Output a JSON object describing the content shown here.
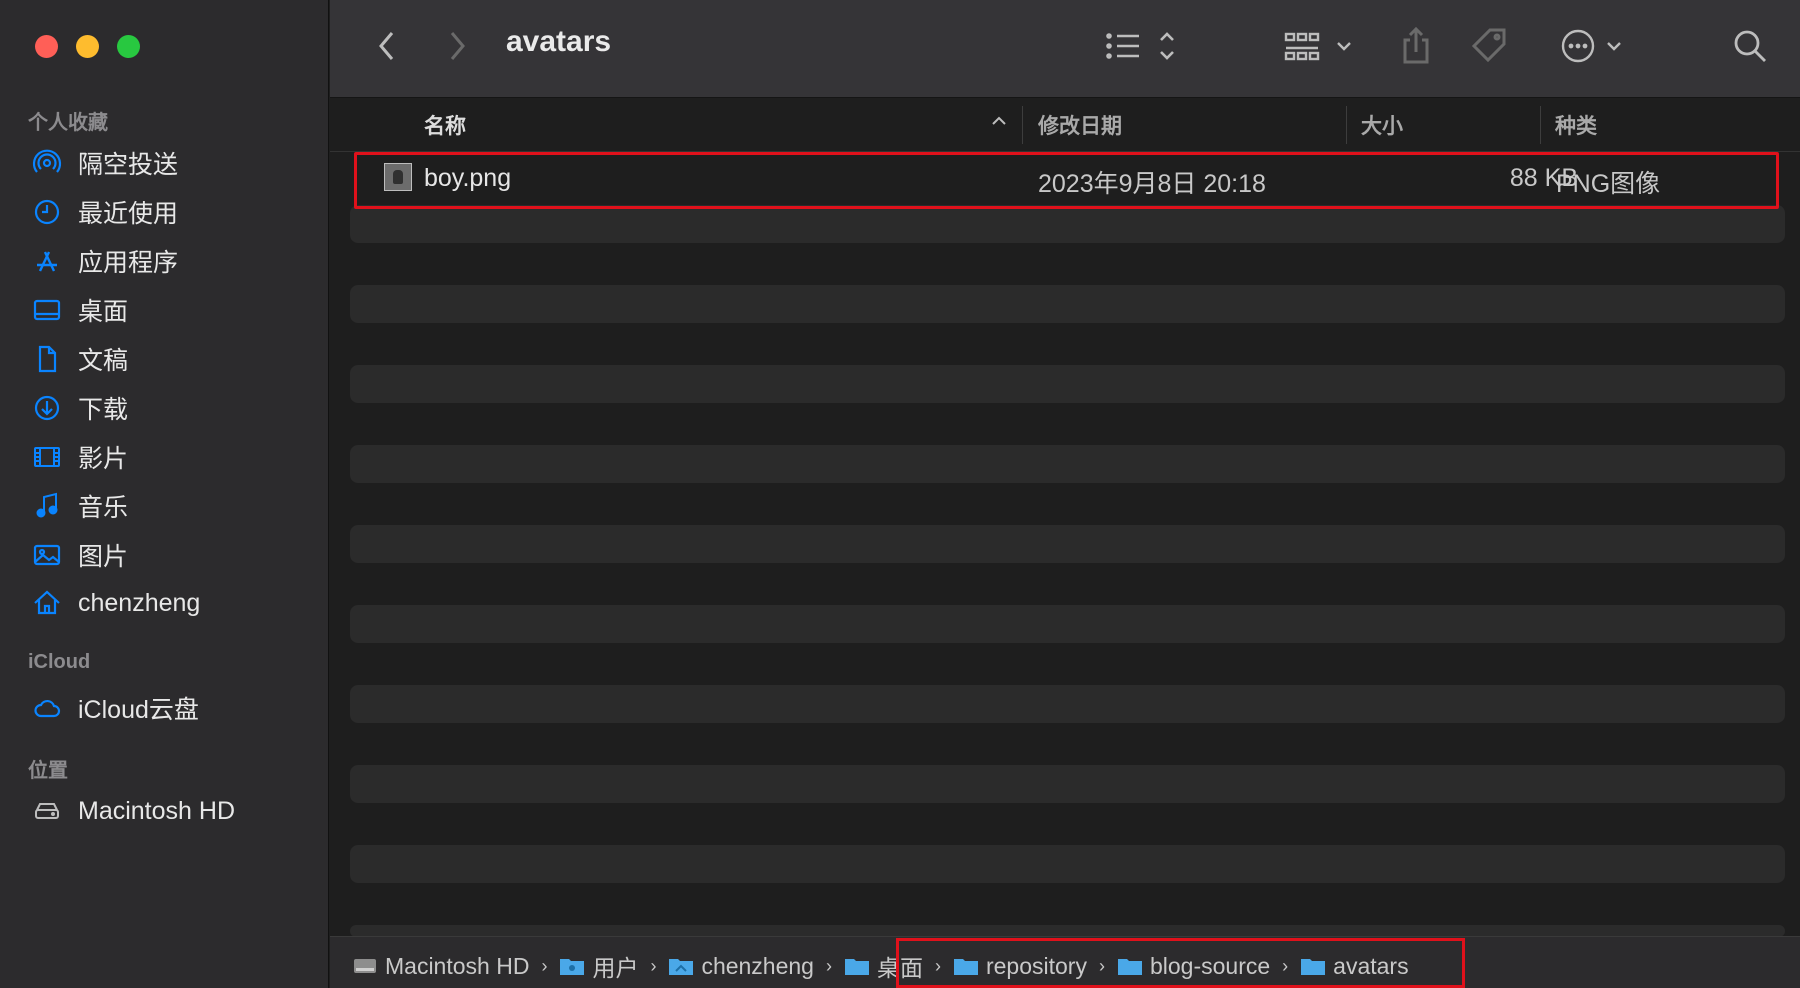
{
  "window": {
    "title": "avatars"
  },
  "sidebar": {
    "favorites_label": "个人收藏",
    "favorites": [
      {
        "label": "隔空投送",
        "icon": "airdrop-icon"
      },
      {
        "label": "最近使用",
        "icon": "clock-icon"
      },
      {
        "label": "应用程序",
        "icon": "applications-icon"
      },
      {
        "label": "桌面",
        "icon": "desktop-icon"
      },
      {
        "label": "文稿",
        "icon": "document-icon"
      },
      {
        "label": "下载",
        "icon": "download-icon"
      },
      {
        "label": "影片",
        "icon": "film-icon"
      },
      {
        "label": "音乐",
        "icon": "music-icon"
      },
      {
        "label": "图片",
        "icon": "photo-icon"
      },
      {
        "label": "chenzheng",
        "icon": "home-icon"
      }
    ],
    "icloud_label": "iCloud",
    "icloud": [
      {
        "label": "iCloud云盘",
        "icon": "cloud-icon"
      }
    ],
    "locations_label": "位置",
    "locations": [
      {
        "label": "Macintosh HD",
        "icon": "disk-icon"
      }
    ]
  },
  "list": {
    "columns": {
      "name": "名称",
      "modified": "修改日期",
      "size": "大小",
      "kind": "种类"
    },
    "files": [
      {
        "name": "boy.png",
        "modified": "2023年9月8日 20:18",
        "size": "88 KB",
        "kind": "PNG图像"
      }
    ]
  },
  "pathbar": {
    "items": [
      "Macintosh HD",
      "用户",
      "chenzheng",
      "桌面",
      "repository",
      "blog-source",
      "avatars"
    ]
  },
  "colors": {
    "accent": "#0a84ff",
    "highlight": "#e0111b",
    "folder": "#4aa8e8"
  }
}
